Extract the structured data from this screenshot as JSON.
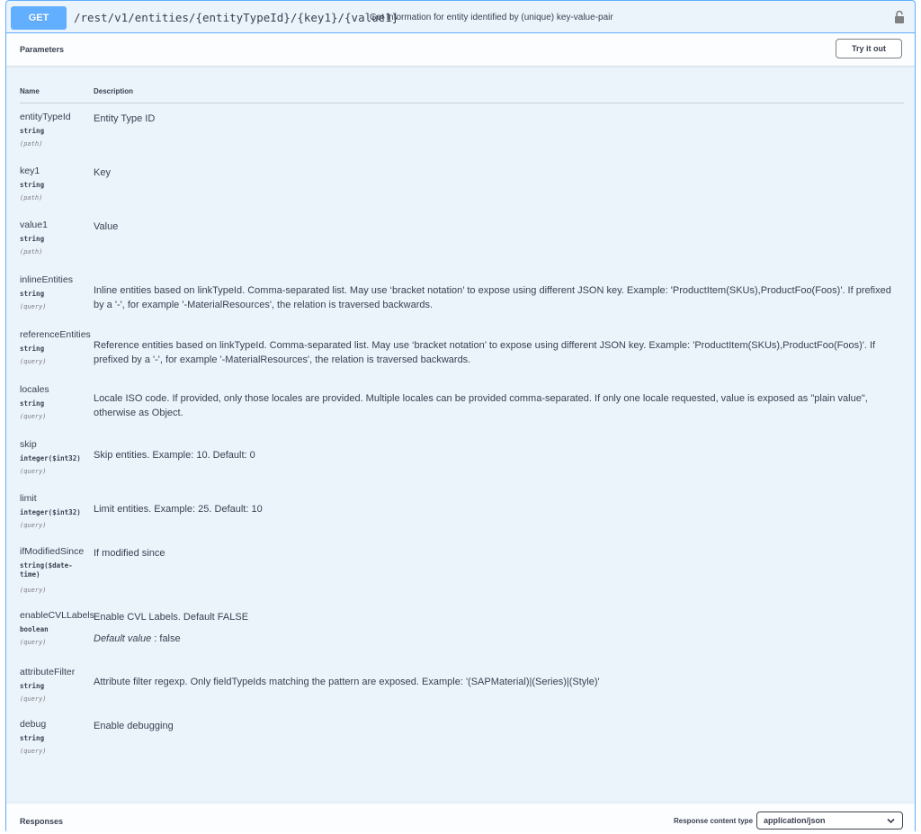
{
  "operation": {
    "method": "GET",
    "path": "/rest/v1/entities/{entityTypeId}/{key1}/{value1}",
    "summary": "Get information for entity identified by (unique) key-value-pair",
    "lock_icon": "lock-icon"
  },
  "parameters_section": {
    "title": "Parameters",
    "try_button": "Try it out",
    "col_name": "Name",
    "col_description": "Description"
  },
  "params": [
    {
      "name": "entityTypeId",
      "type": "string",
      "in": "(path)",
      "description": "Entity Type ID"
    },
    {
      "name": "key1",
      "type": "string",
      "in": "(path)",
      "description": "Key"
    },
    {
      "name": "value1",
      "type": "string",
      "in": "(path)",
      "description": "Value"
    },
    {
      "name": "inlineEntities",
      "type": "string",
      "in": "(query)",
      "description": "Inline entities based on linkTypeId. Comma-separated list. May use ‘bracket notation’ to expose using different JSON key. Example: 'ProductItem(SKUs),ProductFoo(Foos)'. If prefixed by a '-', for example '-MaterialResources', the relation is traversed backwards."
    },
    {
      "name": "referenceEntities",
      "type": "string",
      "in": "(query)",
      "description": "Reference entities based on linkTypeId. Comma-separated list. May use ‘bracket notation’ to expose using different JSON key. Example: 'ProductItem(SKUs),ProductFoo(Foos)'. If prefixed by a '-', for example '-MaterialResources', the relation is traversed backwards."
    },
    {
      "name": "locales",
      "type": "string",
      "in": "(query)",
      "description": "Locale ISO code. If provided, only those locales are provided. Multiple locales can be provided comma-separated. If only one locale requested, value is exposed as \"plain value\", otherwise as Object."
    },
    {
      "name": "skip",
      "type": "integer($int32)",
      "in": "(query)",
      "description": "Skip entities. Example: 10. Default: 0"
    },
    {
      "name": "limit",
      "type": "integer($int32)",
      "in": "(query)",
      "description": "Limit entities. Example: 25. Default: 10"
    },
    {
      "name": "ifModifiedSince",
      "type": "string($date-time)",
      "in": "(query)",
      "description": "If modified since"
    },
    {
      "name": "enableCVLLabels",
      "type": "boolean",
      "in": "(query)",
      "description": "Enable CVL Labels. Default FALSE",
      "default_label": "Default value",
      "default_value": " : false"
    },
    {
      "name": "attributeFilter",
      "type": "string",
      "in": "(query)",
      "description": "Attribute filter regexp. Only fieldTypeIds matching the pattern are exposed. Example: '(SAPMaterial)|(Series)|(Style)'"
    },
    {
      "name": "debug",
      "type": "string",
      "in": "(query)",
      "description": "Enable debugging"
    }
  ],
  "responses_section": {
    "title": "Responses",
    "content_type_label": "Response content type",
    "content_type_value": "application/json"
  },
  "colors": {
    "get_accent": "#61affe",
    "block_bg": "#ebf3fb"
  }
}
